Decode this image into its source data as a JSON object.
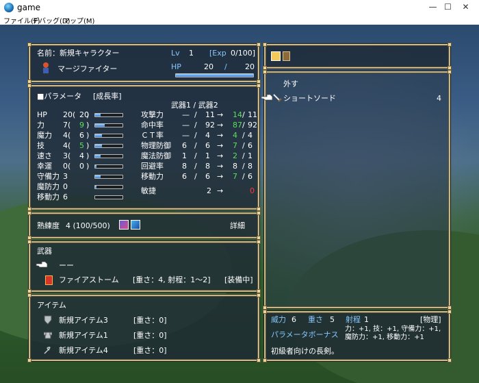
{
  "window": {
    "title": "game",
    "min": "—",
    "max": "☐",
    "close": "✕"
  },
  "menu": [
    "ファイル(F)",
    "デバッグ(D)",
    "マップ(M)"
  ],
  "colors": {
    "frame": "#c9b98a",
    "panel": "#1e2a34",
    "blue": "#84c8ff",
    "green": "#5ee05e",
    "red": "#ff3838"
  },
  "status": {
    "name_label": "名前：新規キャラクター",
    "lv_label": "Lv",
    "lv": "1",
    "exp_label": "[Exp",
    "exp": "0/100]",
    "class": "マージファイター",
    "hp_label": "HP",
    "hp_cur": "20",
    "hp_sep": "/",
    "hp_max": "20",
    "hp_ratio": 1.0
  },
  "params": {
    "header": "■パラメータ",
    "growth": "[成長率]",
    "weapon_header": "武器1 / 武器2",
    "base": [
      {
        "label": "HP",
        "val": "20(",
        "gr": "20",
        ")": ")",
        "g": 0.2
      },
      {
        "label": "力",
        "val": "7(",
        "gr": "9",
        "green": true,
        "g": 0.35
      },
      {
        "label": "魔力",
        "val": "4(",
        "gr": "6",
        "g": 0.25
      },
      {
        "label": "技",
        "val": "4(",
        "gr": "5",
        "green": true,
        "g": 0.25
      },
      {
        "label": "速さ",
        "val": "3(",
        "gr": "4",
        "g": 0.2
      },
      {
        "label": "幸運",
        "val": "0(",
        "gr": "0",
        "g": 0.05
      },
      {
        "label": "守備力",
        "val": "3",
        "gr": "",
        "g": 0.2
      },
      {
        "label": "魔防力",
        "val": "0",
        "gr": "",
        "g": 0.05
      },
      {
        "label": "移動力",
        "val": "6",
        "gr": "",
        "g": 0.0
      }
    ],
    "combat": [
      {
        "label": "攻撃力",
        "w1": "—",
        "w2": "11",
        "to": "14",
        "toc": "green",
        "to2": "11"
      },
      {
        "label": "命中率",
        "w1": "—",
        "w2": "92",
        "to": "87",
        "toc": "green",
        "to2": "92"
      },
      {
        "label": "ＣＴ率",
        "w1": "—",
        "w2": "4",
        "to": "4",
        "toc": "green",
        "to2": "4"
      },
      {
        "label": "物理防御",
        "w1": "6",
        "w2": "6",
        "to": "7",
        "toc": "green",
        "to2": "6"
      },
      {
        "label": "魔法防御",
        "w1": "1",
        "w2": "1",
        "to": "2",
        "toc": "green",
        "to2": "1"
      },
      {
        "label": "回避率",
        "w1": "8",
        "w2": "8",
        "to": "8",
        "toc": "white",
        "to2": "8"
      },
      {
        "label": "移動力",
        "w1": "6",
        "w2": "6",
        "to": "7",
        "toc": "green",
        "to2": "6"
      }
    ],
    "agility": {
      "label": "敏捷",
      "val": "2",
      "to": "0"
    }
  },
  "mastery": {
    "label": "熟練度",
    "value": "4 (100/500)",
    "detail": "詳細"
  },
  "weapons": {
    "header": "武器",
    "empty": "ーー",
    "item_name": "ファイアストーム",
    "item_info": "[重さ：4, 射程：1～2]",
    "equipped": "[装備中]"
  },
  "items": {
    "header": "アイテム",
    "list": [
      {
        "name": "新規アイテム3",
        "info": "[重さ：0]"
      },
      {
        "name": "新規アイテム1",
        "info": "[重さ：0]"
      },
      {
        "name": "新規アイテム4",
        "info": "[重さ：0]"
      }
    ]
  },
  "equip_list": {
    "remove": "外す",
    "item": "ショートソード",
    "count": "4"
  },
  "detail": {
    "power_label": "威力",
    "power": "6",
    "weight_label": "重さ",
    "weight": "5",
    "range_label": "射程",
    "range": "1",
    "type": "[物理]",
    "bonus_label": "パラメータボーナス",
    "bonus1": "力：+1, 技：+1, 守備力：+1,",
    "bonus2": "魔防力：+1, 移動力：+1",
    "desc": "初級者向けの長剣。"
  }
}
